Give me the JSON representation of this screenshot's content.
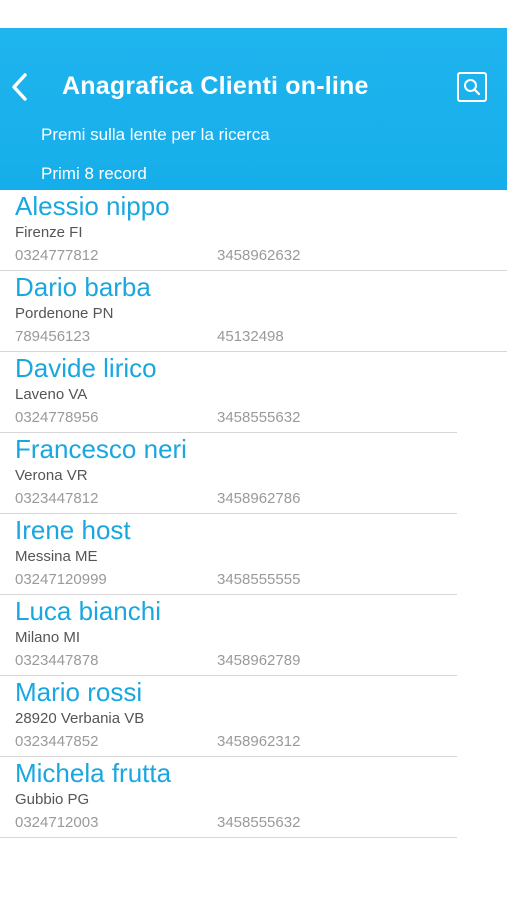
{
  "header": {
    "title": "Anagrafica Clienti on-line",
    "hint": "Premi sulla lente per la ricerca",
    "count": "Primi 8 record",
    "back_icon": "chevron-left-icon",
    "search_icon": "search-icon",
    "background_color": "#1fb4ee"
  },
  "clients": [
    {
      "name": "Alessio nippo",
      "city": "Firenze FI",
      "phone": "0324777812",
      "mobile": "3458962632"
    },
    {
      "name": "Dario barba",
      "city": "Pordenone PN",
      "phone": "789456123",
      "mobile": "45132498"
    },
    {
      "name": "Davide lirico",
      "city": "Laveno VA",
      "phone": "0324778956",
      "mobile": "3458555632"
    },
    {
      "name": "Francesco neri",
      "city": "Verona VR",
      "phone": "0323447812",
      "mobile": "3458962786"
    },
    {
      "name": "Irene host",
      "city": "Messina ME",
      "phone": "03247120999",
      "mobile": "3458555555"
    },
    {
      "name": "Luca bianchi",
      "city": "Milano MI",
      "phone": "0323447878",
      "mobile": "3458962789"
    },
    {
      "name": "Mario rossi",
      "city": "28920 Verbania VB",
      "phone": "0323447852",
      "mobile": "3458962312"
    },
    {
      "name": "Michela frutta",
      "city": "Gubbio PG",
      "phone": "0324712003",
      "mobile": "3458555632"
    }
  ],
  "colors": {
    "accent": "#1aa7e0",
    "separator": "#d6d6d6"
  }
}
